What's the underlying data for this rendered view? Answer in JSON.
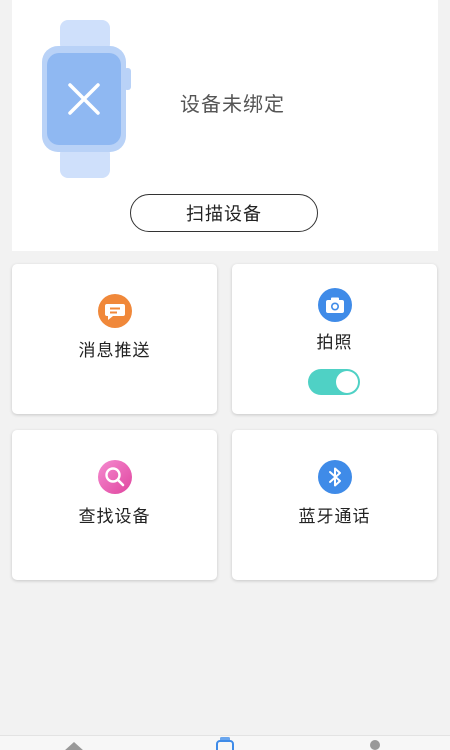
{
  "device": {
    "status": "设备未绑定",
    "scan_label": "扫描设备"
  },
  "cards": {
    "message_push": {
      "label": "消息推送",
      "icon": "message-icon",
      "color": "#f0883a"
    },
    "camera": {
      "label": "拍照",
      "icon": "camera-icon",
      "color": "#3f8be8",
      "toggle_on": true
    },
    "find_device": {
      "label": "查找设备",
      "icon": "search-icon",
      "color": "#e95fb0"
    },
    "bluetooth_call": {
      "label": "蓝牙通话",
      "icon": "bluetooth-icon",
      "color": "#3f8be8"
    }
  },
  "colors": {
    "toggle_on": "#4fd1c5",
    "watch": "#9dc3f5"
  },
  "bottom_nav": {
    "items": [
      {
        "icon": "home-icon"
      },
      {
        "icon": "watch-icon"
      },
      {
        "icon": "profile-icon"
      }
    ]
  }
}
